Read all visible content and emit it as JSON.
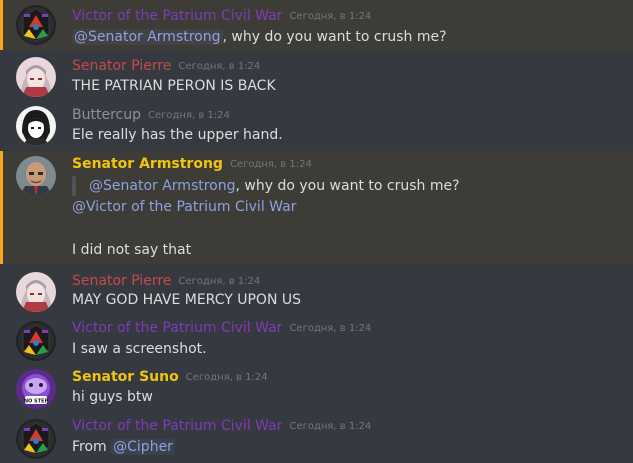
{
  "colors": {
    "background": "#36393f",
    "mention_highlight": "#3e3c36",
    "mention_border": "#faa61a",
    "victor": "#7e3bb8",
    "pierre": "#c44a4a",
    "buttercup": "#8e9297",
    "armstrong": "#f1c40f",
    "suno": "#f1c40f",
    "mention_text": "#8ea1e1",
    "timestamp": "#72767d"
  },
  "messages": [
    {
      "author": "Victor of the Patrium Civil War",
      "timestamp": "Сегодня, в 1:24",
      "mention": "@Senator Armstrong",
      "text_after": ", why do you want to crush me?",
      "avatar_icon": "traffic-light-icon"
    },
    {
      "author": "Senator Pierre",
      "timestamp": "Сегодня, в 1:24",
      "text": "THE PATRIAN PERON IS BACK",
      "avatar_icon": "anime-portrait-icon"
    },
    {
      "author": "Buttercup",
      "timestamp": "Сегодня, в 1:24",
      "text": "Ele really has the upper hand.",
      "avatar_icon": "manga-face-icon"
    },
    {
      "author": "Senator Armstrong",
      "timestamp": "Сегодня, в 1:24",
      "quote_mention": "@Senator Armstrong",
      "quote_text": ", why do you want to crush me?",
      "reply_mention": "@Victor of the Patrium Civil War",
      "text_final": "I did not say that",
      "avatar_icon": "bald-man-icon"
    },
    {
      "author": "Senator Pierre",
      "timestamp": "Сегодня, в 1:24",
      "text": "MAY GOD HAVE MERCY UPON US",
      "avatar_icon": "anime-portrait-icon"
    },
    {
      "author": "Victor of the Patrium Civil War",
      "timestamp": "Сегодня, в 1:24",
      "text": "I saw a screenshot.",
      "avatar_icon": "traffic-light-icon"
    },
    {
      "author": "Senator Suno",
      "timestamp": "Сегодня, в 1:24",
      "text": "hi guys btw",
      "avatar_icon": "no-step-icon",
      "avatar_text": "NO STEP"
    },
    {
      "author": "Victor of the Patrium Civil War",
      "timestamp": "Сегодня, в 1:24",
      "text_before": "From ",
      "mention": "@Cipher",
      "avatar_icon": "traffic-light-icon"
    }
  ]
}
